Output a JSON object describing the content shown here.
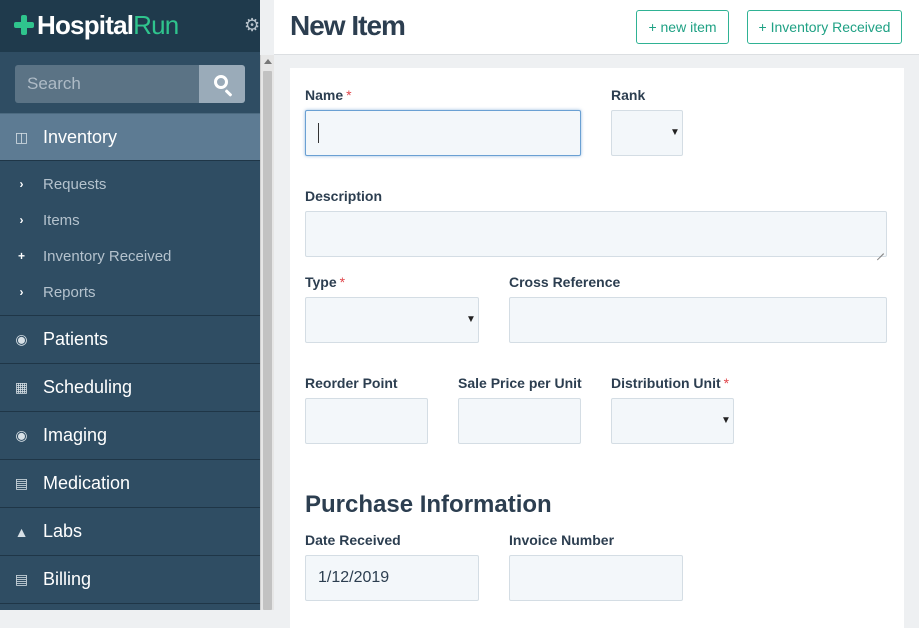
{
  "brand": {
    "part1": "Hospital",
    "part2": "Run"
  },
  "search": {
    "placeholder": "Search"
  },
  "nav": {
    "inventory": "Inventory",
    "sub": [
      "Requests",
      "Items",
      "Inventory Received",
      "Reports"
    ],
    "items": [
      "Patients",
      "Scheduling",
      "Imaging",
      "Medication",
      "Labs",
      "Billing"
    ]
  },
  "header": {
    "title": "New Item",
    "new_item_btn": "+ new item",
    "inventory_received_btn": "+ Inventory Received"
  },
  "form": {
    "name_label": "Name",
    "name_value": "",
    "rank_label": "Rank",
    "rank_value": "",
    "description_label": "Description",
    "description_value": "",
    "type_label": "Type",
    "type_value": "",
    "cross_reference_label": "Cross Reference",
    "cross_reference_value": "",
    "reorder_point_label": "Reorder Point",
    "reorder_point_value": "",
    "sale_price_label": "Sale Price per Unit",
    "sale_price_value": "",
    "distribution_unit_label": "Distribution Unit",
    "distribution_unit_value": "",
    "required_mark": "*"
  },
  "purchase": {
    "heading": "Purchase Information",
    "date_received_label": "Date Received",
    "date_received_value": "1/12/2019",
    "invoice_number_label": "Invoice Number",
    "invoice_number_value": ""
  },
  "colors": {
    "accent": "#2fc48d",
    "sidebar": "#2f4d63",
    "active_nav": "#5d7b93",
    "button_border": "#2fb294",
    "required": "#e0464b"
  },
  "icons": [
    "plus-cross-icon",
    "gear-icon",
    "search-icon",
    "box-icon",
    "chevron-right-icon",
    "plus-icon",
    "patients-icon",
    "calendar-icon",
    "camera-icon",
    "document-icon",
    "microscope-icon",
    "credit-card-icon"
  ]
}
